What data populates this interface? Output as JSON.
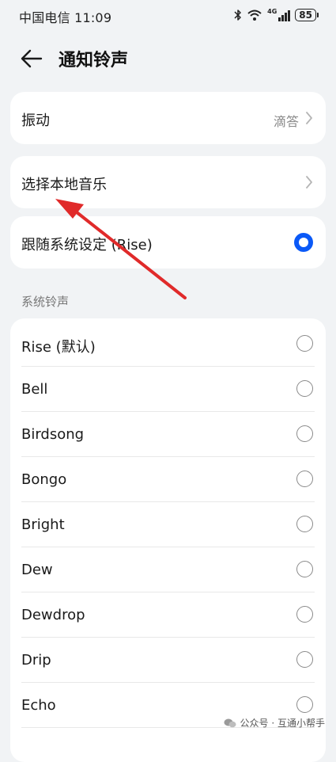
{
  "status_bar": {
    "carrier_time": "中国电信 11:09",
    "network": "4G",
    "battery": "85"
  },
  "header": {
    "title": "通知铃声"
  },
  "vibration": {
    "label": "振动",
    "value": "滴答"
  },
  "local_music": {
    "label": "选择本地音乐"
  },
  "follow_system": {
    "label": "跟随系统设定 (Rise)",
    "selected": true
  },
  "system_ringtones": {
    "title": "系统铃声",
    "items": [
      {
        "label": "Rise (默认)"
      },
      {
        "label": "Bell"
      },
      {
        "label": "Birdsong"
      },
      {
        "label": "Bongo"
      },
      {
        "label": "Bright"
      },
      {
        "label": "Dew"
      },
      {
        "label": "Dewdrop"
      },
      {
        "label": "Drip"
      },
      {
        "label": "Echo"
      }
    ]
  },
  "watermark": {
    "text": "公众号 · 互通小帮手"
  },
  "colors": {
    "accent": "#0a59f7",
    "annotation_arrow": "#e02a2a",
    "background": "#f1f3f5"
  },
  "icons": [
    "bluetooth-icon",
    "wifi-icon",
    "signal-icon",
    "battery-icon",
    "back-arrow-icon",
    "chevron-right-icon",
    "radio-selected-icon",
    "radio-unselected-icon",
    "wechat-icon"
  ]
}
